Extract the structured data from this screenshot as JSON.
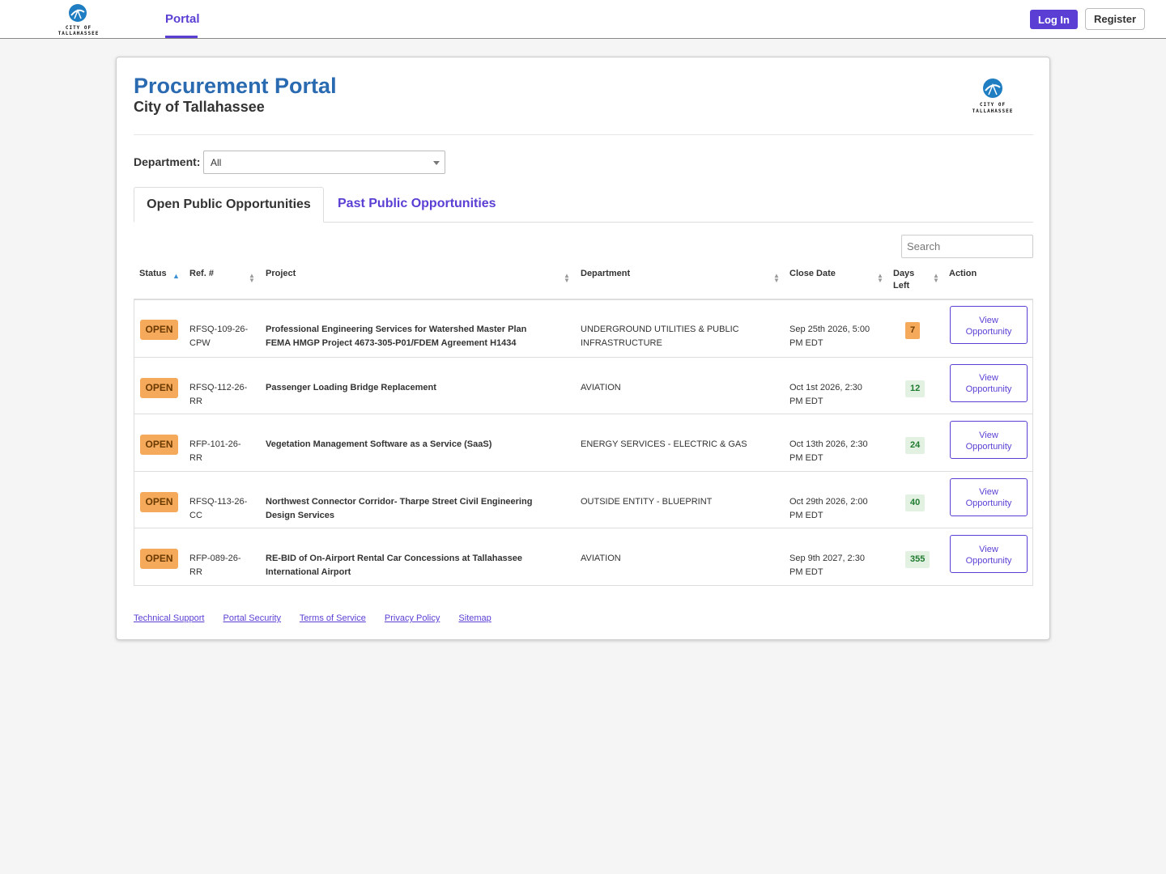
{
  "nav": {
    "logo_alt": "City of Tallahassee",
    "logo_text_line1": "CITY OF",
    "logo_text_line2": "TALLAHASSEE",
    "portal_label": "Portal",
    "login_label": "Log In",
    "register_label": "Register"
  },
  "header": {
    "title": "Procurement Portal",
    "subtitle": "City of Tallahassee"
  },
  "filter": {
    "department_label": "Department:",
    "department_value": "All"
  },
  "tabs": {
    "open_label": "Open Public Opportunities",
    "past_label": "Past Public Opportunities"
  },
  "search": {
    "placeholder": "Search"
  },
  "table": {
    "headers": {
      "status": "Status",
      "ref": "Ref. #",
      "project": "Project",
      "department": "Department",
      "close_date": "Close Date",
      "days_left_1": "Days",
      "days_left_2": "Left",
      "action": "Action"
    },
    "rows": [
      {
        "status": "OPEN",
        "ref_1": "RFSQ-109-26-",
        "ref_2": "CPW",
        "project_1": "Professional Engineering Services for Watershed Master Plan",
        "project_2": "FEMA HMGP Project 4673-305-P01/FDEM Agreement H1434",
        "department_1": "UNDERGROUND UTILITIES & PUBLIC",
        "department_2": "INFRASTRUCTURE",
        "close_1": "Sep 25th 2026, 5:00",
        "close_2": "PM EDT",
        "days_left": "7",
        "action_1": "View",
        "action_2": "Opportunity"
      },
      {
        "status": "OPEN",
        "ref_1": "RFSQ-112-26-",
        "ref_2": "RR",
        "project_1": "Passenger Loading Bridge Replacement",
        "project_2": "",
        "department_1": "AVIATION",
        "department_2": "",
        "close_1": "Oct 1st 2026, 2:30",
        "close_2": "PM EDT",
        "days_left": "12",
        "action_1": "View",
        "action_2": "Opportunity"
      },
      {
        "status": "OPEN",
        "ref_1": "RFP-101-26-",
        "ref_2": "RR",
        "project_1": "Vegetation Management Software as a Service (SaaS)",
        "project_2": "",
        "department_1": "ENERGY SERVICES - ELECTRIC & GAS",
        "department_2": "",
        "close_1": "Oct 13th 2026, 2:30",
        "close_2": "PM EDT",
        "days_left": "24",
        "action_1": "View",
        "action_2": "Opportunity"
      },
      {
        "status": "OPEN",
        "ref_1": "RFSQ-113-26-",
        "ref_2": "CC",
        "project_1": "Northwest Connector Corridor- Tharpe Street Civil Engineering",
        "project_2": "Design Services",
        "department_1": "OUTSIDE ENTITY - BLUEPRINT",
        "department_2": "",
        "close_1": "Oct 29th 2026, 2:00",
        "close_2": "PM EDT",
        "days_left": "40",
        "action_1": "View",
        "action_2": "Opportunity"
      },
      {
        "status": "OPEN",
        "ref_1": "RFP-089-26-",
        "ref_2": "RR",
        "project_1": "RE-BID of On-Airport Rental Car Concessions at Tallahassee",
        "project_2": "International Airport",
        "department_1": "AVIATION",
        "department_2": "",
        "close_1": "Sep 9th 2027, 2:30",
        "close_2": "PM EDT",
        "days_left": "355",
        "action_1": "View",
        "action_2": "Opportunity"
      }
    ]
  },
  "footer": {
    "links": [
      "Technical Support",
      "Portal Security",
      "Terms of Service",
      "Privacy Policy",
      "Sitemap"
    ]
  },
  "colors": {
    "accent": "#5b3fd4",
    "title_blue": "#2a6ab0",
    "open_badge": "#f5a95a",
    "days_ok_bg": "#e3f1e3",
    "days_ok_text": "#1e7a2e"
  }
}
